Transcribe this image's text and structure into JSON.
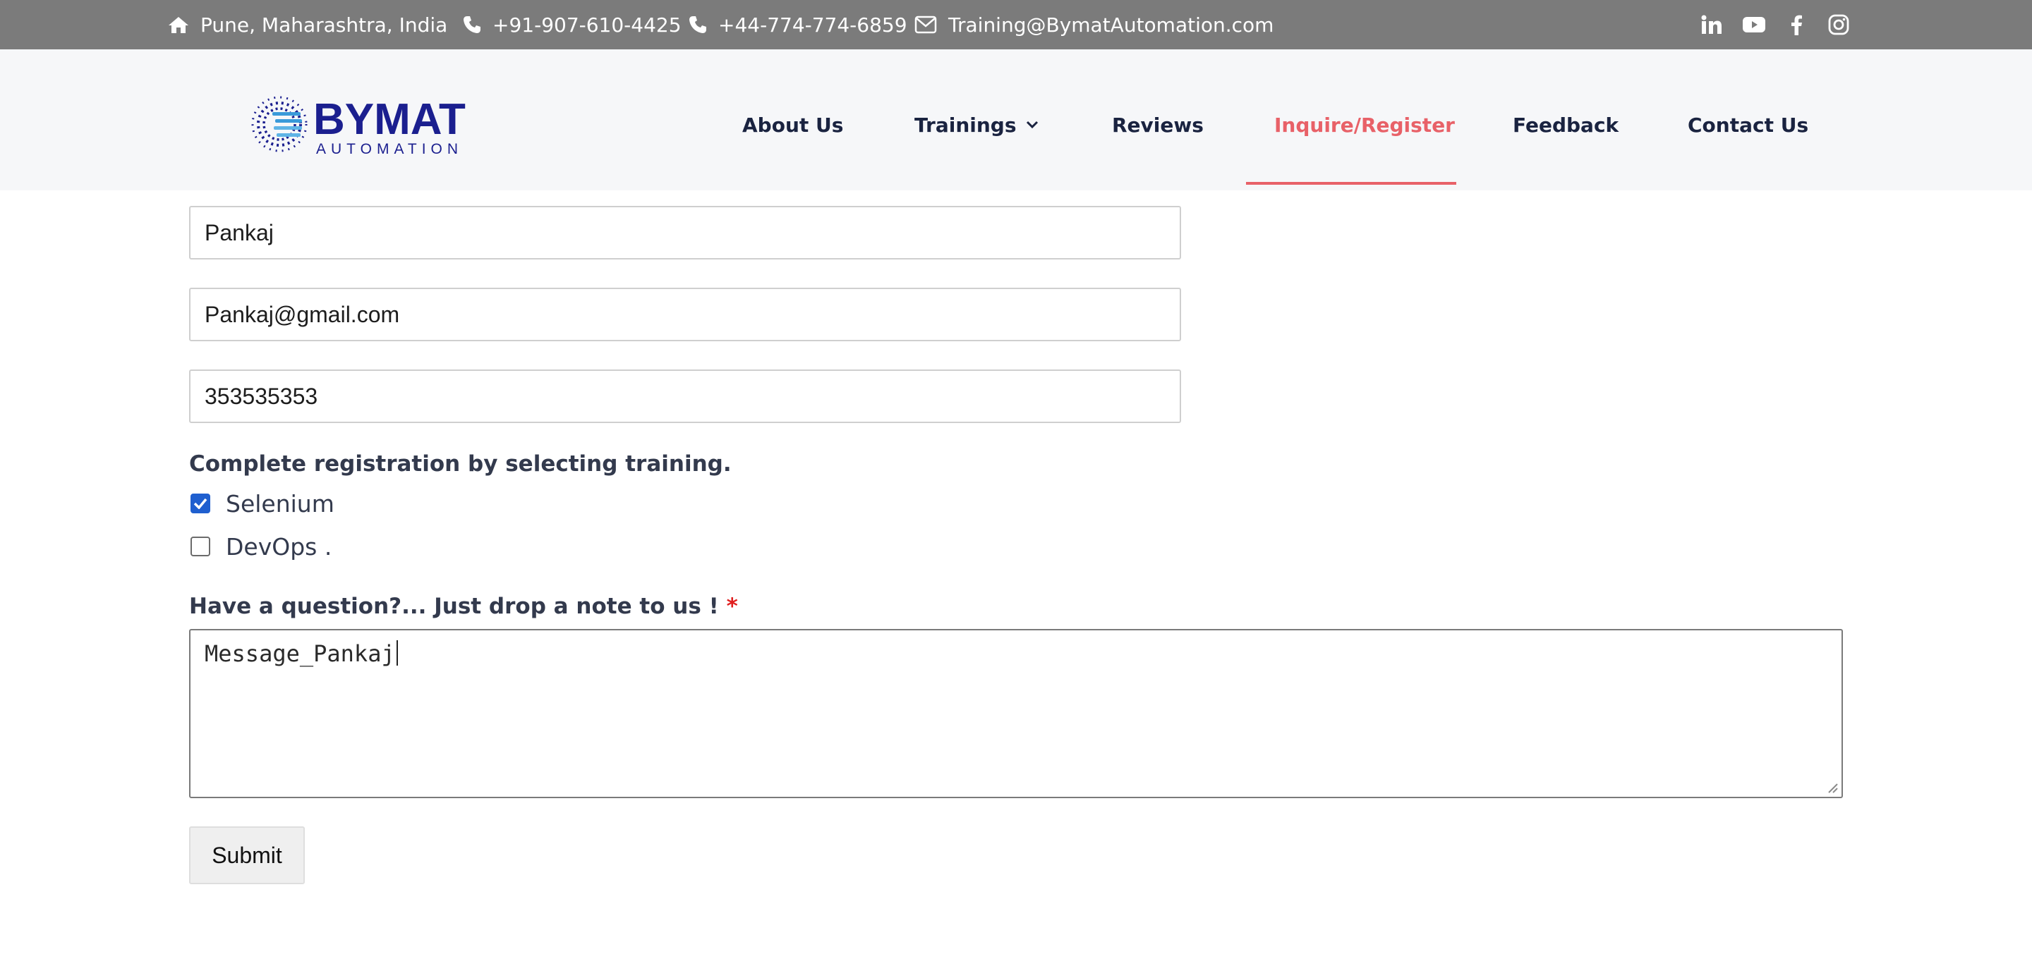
{
  "topbar": {
    "location": "Pune, Maharashtra, India",
    "phone_india": "+91-907-610-4425",
    "phone_uk": "+44-774-774-6859",
    "email": "Training@BymatAutomation.com",
    "icons": [
      "home-icon",
      "phone-icon",
      "phone-icon",
      "mail-icon",
      "linkedin-icon",
      "youtube-icon",
      "facebook-icon",
      "instagram-icon"
    ]
  },
  "brand": {
    "name": "BYMAT",
    "tagline": "AUTOMATION",
    "color": "#1b1f8f",
    "accent": "#3a9ad9"
  },
  "nav": {
    "items": [
      {
        "label": "About Us"
      },
      {
        "label": "Trainings"
      },
      {
        "label": "Reviews"
      },
      {
        "label": "Inquire/Register",
        "active": true
      },
      {
        "label": "Feedback"
      },
      {
        "label": "Contact Us"
      }
    ],
    "active_color": "#e86168"
  },
  "form": {
    "name_value": "Pankaj",
    "email_value": "Pankaj@gmail.com",
    "phone_value": "353535353",
    "training_heading": "Complete registration by selecting training.",
    "trainings": [
      {
        "label": "Selenium",
        "checked": true
      },
      {
        "label": "DevOps .",
        "checked": false
      }
    ],
    "question_label": "Have a question?... Just drop a note to us !",
    "required_marker": "*",
    "message_value": "Message_Pankaj",
    "submit_label": "Submit",
    "checkbox_color": "#1f5fcf"
  }
}
